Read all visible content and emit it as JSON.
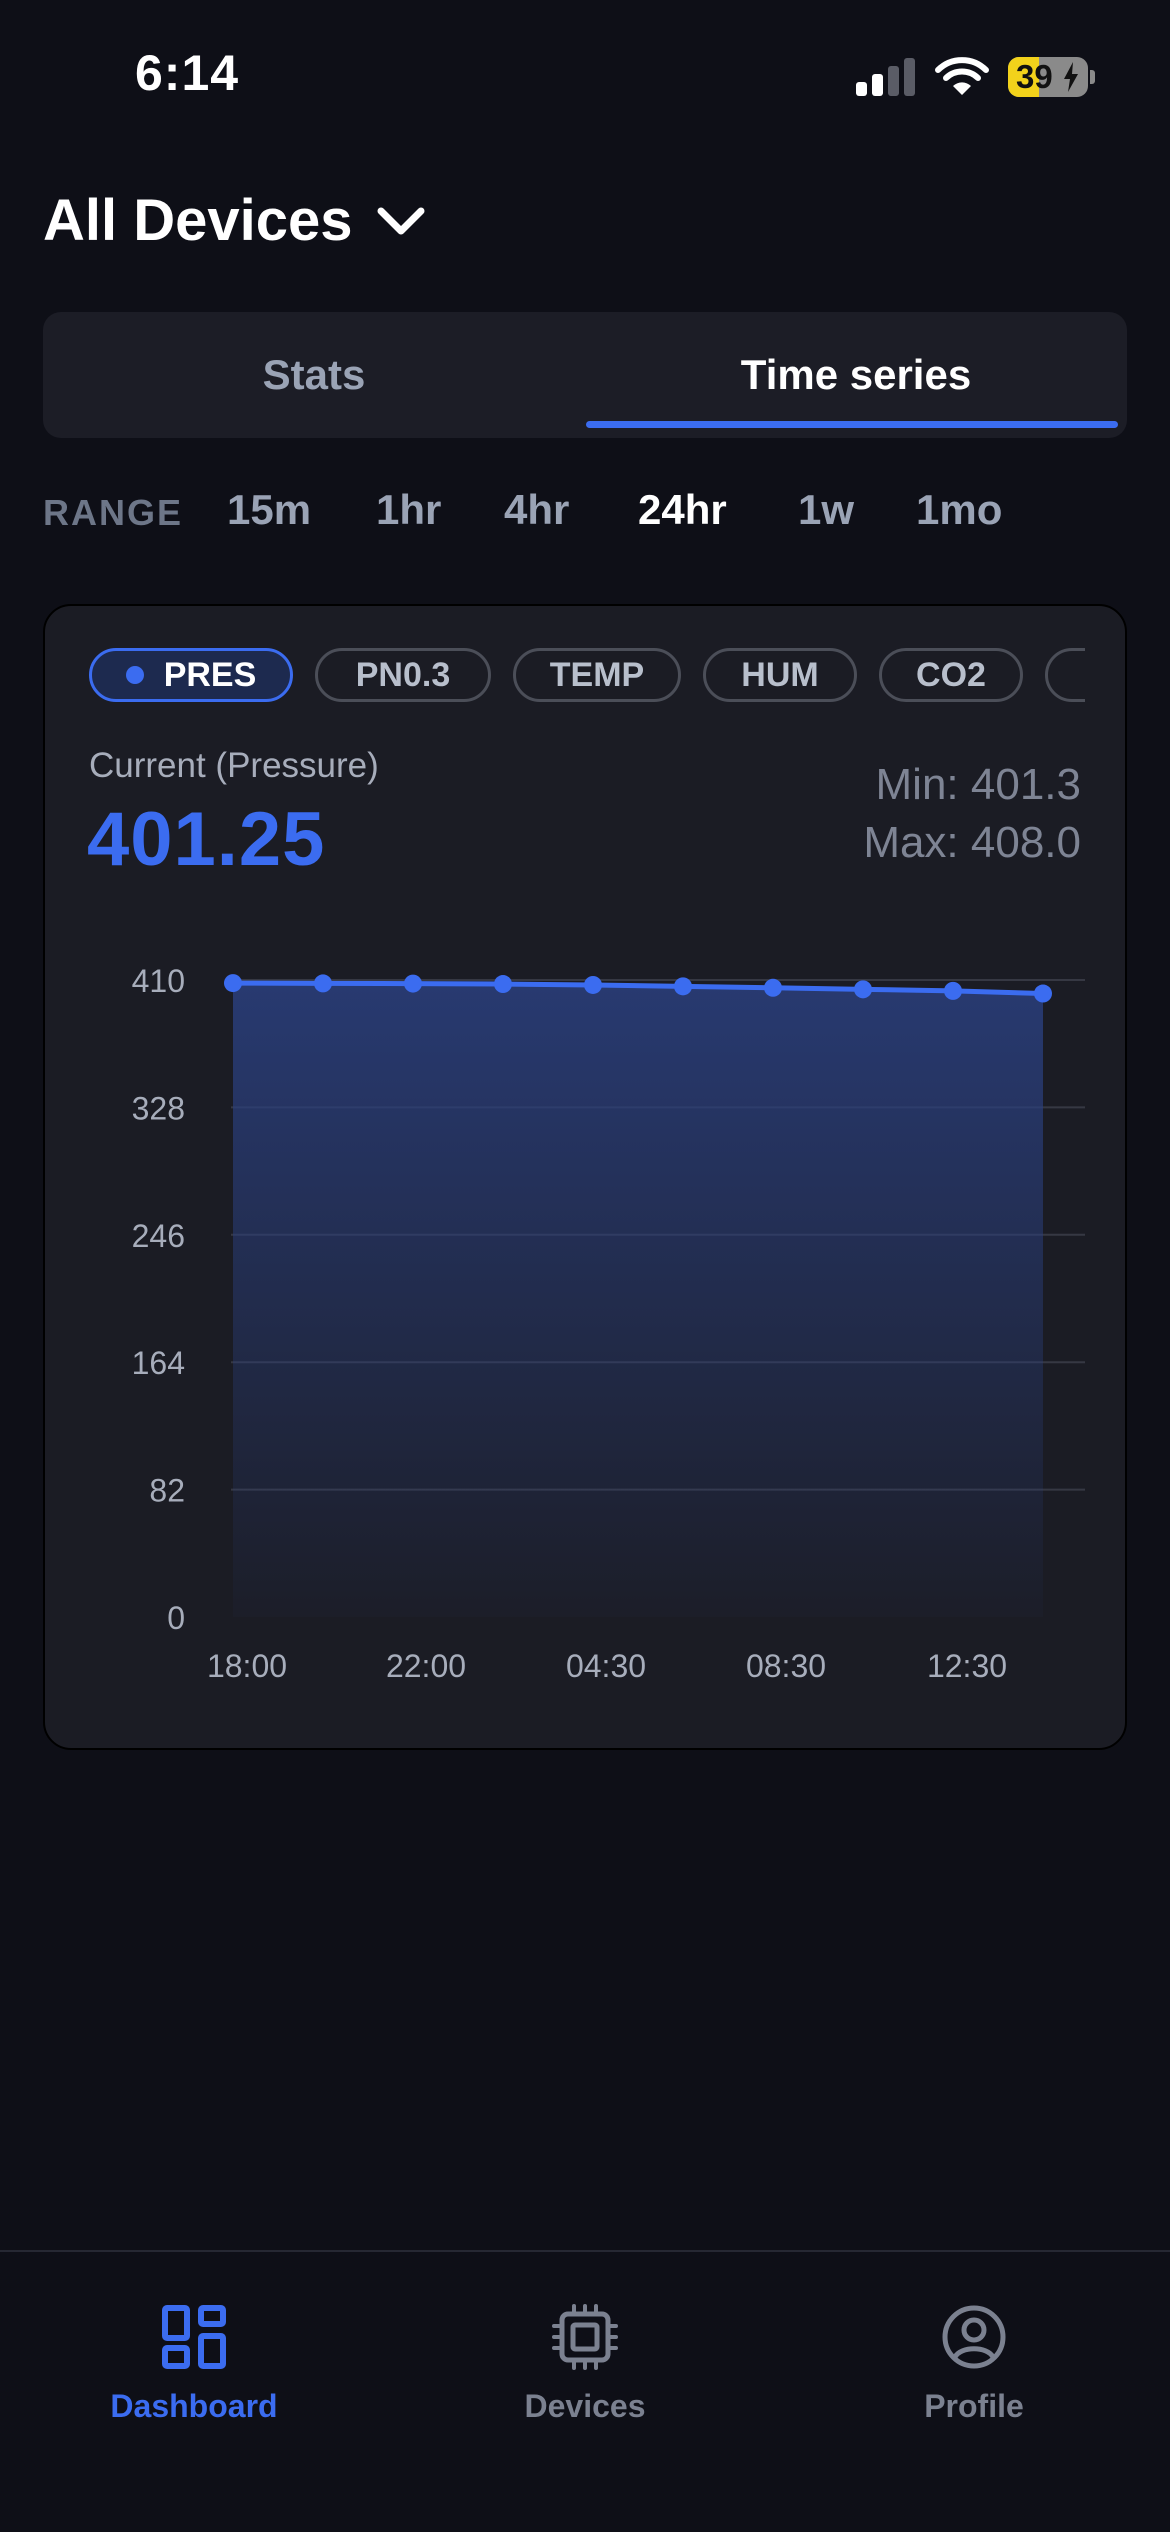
{
  "status_bar": {
    "time": "6:14",
    "battery": "39"
  },
  "header": {
    "title": "All Devices"
  },
  "tabs": [
    {
      "label": "Stats",
      "active": false
    },
    {
      "label": "Time series",
      "active": true
    }
  ],
  "range": {
    "label": "RANGE",
    "options": [
      "15m",
      "1hr",
      "4hr",
      "24hr",
      "1w",
      "1mo"
    ],
    "selected": "24hr"
  },
  "metrics": {
    "chips": [
      "PRES",
      "PN0.3",
      "TEMP",
      "HUM",
      "CO2"
    ],
    "selected": "PRES",
    "current_label": "Current (Pressure)",
    "current_value": "401.25",
    "min_text": "Min: 401.3",
    "max_text": "Max: 408.0"
  },
  "chart_data": {
    "type": "area",
    "x": [
      "18:00",
      "20:00",
      "22:00",
      "02:00",
      "04:30",
      "06:30",
      "08:30",
      "10:30",
      "12:30",
      "14:30"
    ],
    "xtick_labels": [
      "18:00",
      "22:00",
      "04:30",
      "08:30",
      "12:30"
    ],
    "series": [
      {
        "values": [
          408.0,
          407.8,
          407.7,
          407.4,
          406.8,
          405.9,
          405.0,
          404.0,
          403.0,
          401.3
        ],
        "color": "#3b6cf0"
      }
    ],
    "yticks": [
      0,
      82,
      164,
      246,
      328,
      410
    ],
    "ylim": [
      0,
      410
    ],
    "grid": true
  },
  "nav": [
    {
      "label": "Dashboard",
      "icon": "dashboard-icon",
      "active": true
    },
    {
      "label": "Devices",
      "icon": "chip-icon",
      "active": false
    },
    {
      "label": "Profile",
      "icon": "user-circle-icon",
      "active": false
    }
  ],
  "colors": {
    "accent": "#3b6cf0",
    "background": "#0e0f17",
    "card": "#1b1c24"
  }
}
